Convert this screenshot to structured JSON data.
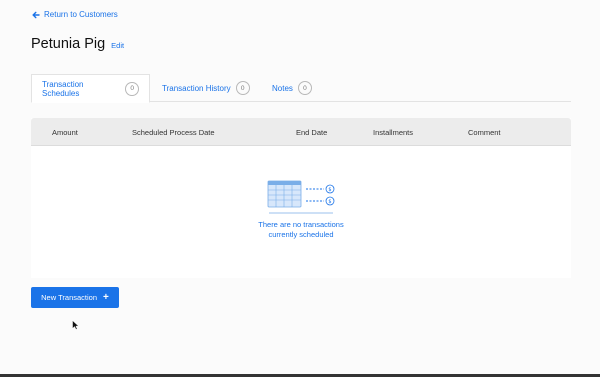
{
  "nav": {
    "back_label": "Return to Customers"
  },
  "customer": {
    "name": "Petunia Pig",
    "edit_label": "Edit"
  },
  "tabs": [
    {
      "label": "Transaction Schedules",
      "count": "0",
      "active": true
    },
    {
      "label": "Transaction History",
      "count": "0",
      "active": false
    },
    {
      "label": "Notes",
      "count": "0",
      "active": false
    }
  ],
  "table": {
    "columns": [
      "Amount",
      "Scheduled Process Date",
      "End Date",
      "Installments",
      "Comment"
    ]
  },
  "empty_state": {
    "line1": "There are no transactions",
    "line2": "currently scheduled",
    "icon": "calendar-transactions-icon"
  },
  "actions": {
    "new_transaction_label": "New Transaction",
    "new_transaction_icon": "plus-icon"
  },
  "colors": {
    "accent": "#1a73e8",
    "header_bg": "#ececec"
  }
}
